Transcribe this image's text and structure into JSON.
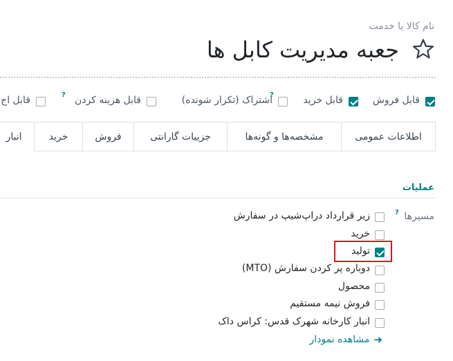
{
  "product": {
    "name_label": "نام کالا یا خدمت",
    "name": "جعبه مدیریت کابل ها"
  },
  "options": [
    {
      "label": "قابل فروش",
      "checked": true
    },
    {
      "label": "قابل خرید",
      "checked": true
    },
    {
      "label": "اشتراک (تکرار شونده)",
      "checked": false,
      "help": "?"
    },
    {
      "label": "قابل هزینه کردن",
      "checked": false,
      "help": "?"
    },
    {
      "label": "قابل اج",
      "checked": false
    }
  ],
  "tabs": [
    "اطلاعات عمومی",
    "مشخصه‌ها و گونه‌ها",
    "جزییات گارانتی",
    "فروش",
    "خرید",
    "انبار"
  ],
  "active_tab": "انبار",
  "operations": {
    "title": "عملیات",
    "routes_label": "مسیرها",
    "routes_help": "?",
    "routes": [
      {
        "label": "زیر قرارداد دراپ‌شیپ در سفارش",
        "checked": false
      },
      {
        "label": "خرید",
        "checked": false
      },
      {
        "label": "تولید",
        "checked": true
      },
      {
        "label": "دوباره پر کردن سفارش (MTO)",
        "checked": false
      },
      {
        "label": "محصول",
        "checked": false
      },
      {
        "label": "فروش نیمه مستقیم",
        "checked": false
      },
      {
        "label": "انبار کارخانه شهرک قدس: کراس داک",
        "checked": false
      }
    ],
    "diagram_link": "مشاهده نمودار"
  },
  "colors": {
    "accent": "#017e84",
    "highlight": "#e0141e"
  }
}
